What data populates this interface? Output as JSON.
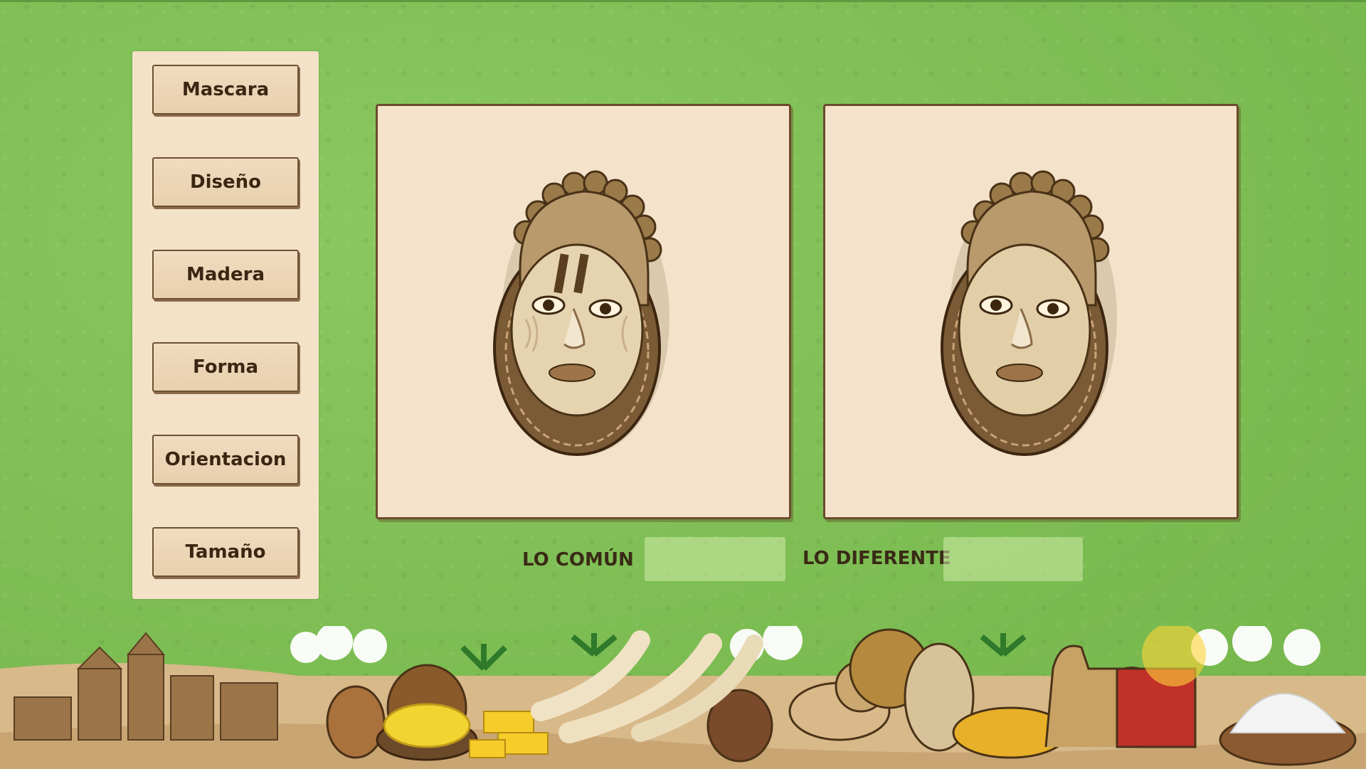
{
  "words": [
    {
      "label": "Mascara"
    },
    {
      "label": "Diseño"
    },
    {
      "label": "Madera"
    },
    {
      "label": "Forma"
    },
    {
      "label": "Orientacion"
    },
    {
      "label": "Tamaño"
    }
  ],
  "cards": [
    {
      "name": "mask-with-marks-card",
      "image": "african-mask-with-scarification-icon"
    },
    {
      "name": "mask-plain-card",
      "image": "african-mask-plain-icon"
    }
  ],
  "answers": {
    "common_label": "LO COMÚN",
    "different_label": "LO DIFERENTE"
  },
  "colors": {
    "background": "#7fbf55",
    "panel": "#f3e2c8",
    "card": "#f4e3ca",
    "border": "#6b4b2e",
    "text": "#3a2612"
  },
  "scenery": "african-market-scenery-icon"
}
